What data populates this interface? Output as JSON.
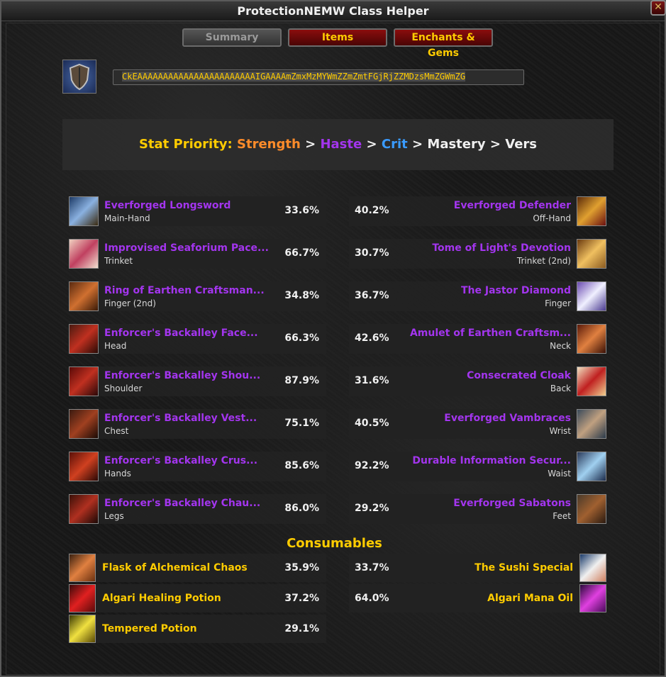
{
  "window": {
    "title": "ProtectionNEMW Class Helper",
    "close_glyph": "✕"
  },
  "tabs": [
    {
      "label": "Summary"
    },
    {
      "label": "Items"
    },
    {
      "label": "Enchants & Gems"
    }
  ],
  "export_string": "CkEAAAAAAAAAAAAAAAAAAAAAAAIGAAAAmZmxMzMYWmZZmZmtFGjRjZZMDzsMmZGWmZG",
  "stat_priority": {
    "label": "Stat Priority:",
    "stats": [
      "Strength",
      "Haste",
      "Crit",
      "Mastery",
      "Vers"
    ],
    "separator": ">"
  },
  "items_left": [
    {
      "name": "Everforged Longsword",
      "slot": "Main-Hand",
      "pct": "33.6%",
      "icon": "sword-icon"
    },
    {
      "name": "Improvised Seaforium Pace...",
      "slot": "Trinket",
      "pct": "66.7%",
      "icon": "trinket-icon"
    },
    {
      "name": "Ring of Earthen Craftsman...",
      "slot": "Finger (2nd)",
      "pct": "34.8%",
      "icon": "ring-icon"
    },
    {
      "name": "Enforcer's Backalley Face...",
      "slot": "Head",
      "pct": "66.3%",
      "icon": "helm-icon"
    },
    {
      "name": "Enforcer's Backalley Shou...",
      "slot": "Shoulder",
      "pct": "87.9%",
      "icon": "shoulder-icon"
    },
    {
      "name": "Enforcer's Backalley Vest...",
      "slot": "Chest",
      "pct": "75.1%",
      "icon": "chest-icon"
    },
    {
      "name": "Enforcer's Backalley Crus...",
      "slot": "Hands",
      "pct": "85.6%",
      "icon": "gauntlet-icon"
    },
    {
      "name": "Enforcer's Backalley Chau...",
      "slot": "Legs",
      "pct": "86.0%",
      "icon": "legs-icon"
    }
  ],
  "items_right": [
    {
      "name": "Everforged Defender",
      "slot": "Off-Hand",
      "pct": "40.2%",
      "icon": "shield-icon"
    },
    {
      "name": "Tome of Light's Devotion",
      "slot": "Trinket (2nd)",
      "pct": "30.7%",
      "icon": "book-icon"
    },
    {
      "name": "The Jastor Diamond",
      "slot": "Finger",
      "pct": "36.7%",
      "icon": "diamond-ring-icon"
    },
    {
      "name": "Amulet of Earthen Craftsm...",
      "slot": "Neck",
      "pct": "42.6%",
      "icon": "amulet-icon"
    },
    {
      "name": "Consecrated Cloak",
      "slot": "Back",
      "pct": "31.6%",
      "icon": "cloak-icon"
    },
    {
      "name": "Everforged Vambraces",
      "slot": "Wrist",
      "pct": "40.5%",
      "icon": "bracer-icon"
    },
    {
      "name": "Durable Information Secur...",
      "slot": "Waist",
      "pct": "92.2%",
      "icon": "belt-icon"
    },
    {
      "name": "Everforged Sabatons",
      "slot": "Feet",
      "pct": "29.2%",
      "icon": "boots-icon"
    }
  ],
  "consumables_title": "Consumables",
  "consumables_left": [
    {
      "name": "Flask of Alchemical Chaos",
      "pct": "35.9%",
      "icon": "flask-icon"
    },
    {
      "name": "Algari Healing Potion",
      "pct": "37.2%",
      "icon": "health-potion-icon"
    },
    {
      "name": "Tempered Potion",
      "pct": "29.1%",
      "icon": "potion-icon"
    }
  ],
  "consumables_right": [
    {
      "name": "The Sushi Special",
      "pct": "33.7%",
      "icon": "food-icon"
    },
    {
      "name": "Algari Mana Oil",
      "pct": "64.0%",
      "icon": "oil-icon"
    }
  ],
  "colors": {
    "epic": "#a335ee",
    "gold": "#ffcc00",
    "strength": "#ff8c2a",
    "crit": "#3a9bff"
  }
}
